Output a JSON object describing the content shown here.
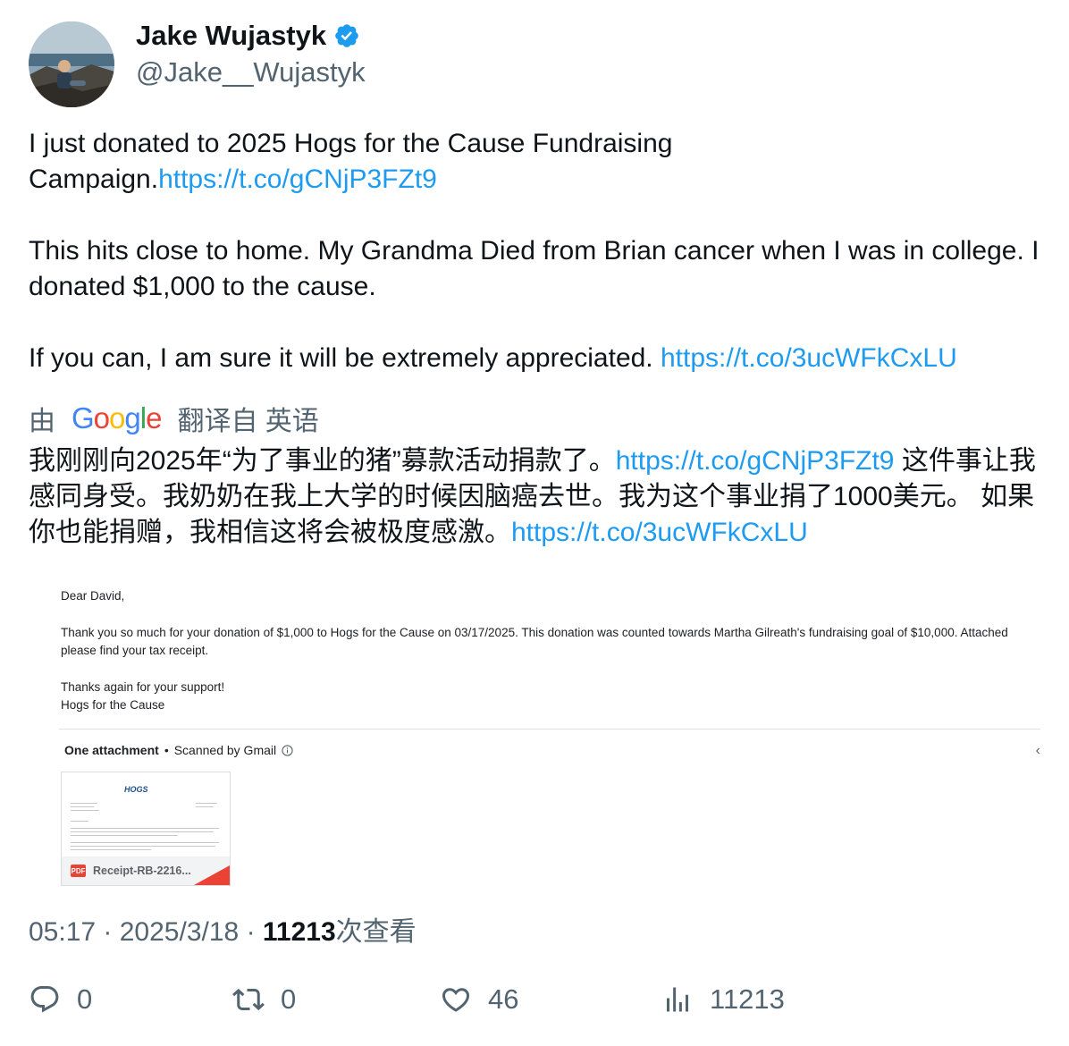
{
  "author": {
    "display_name": "Jake Wujastyk",
    "handle": "@Jake__Wujastyk",
    "verified_icon": "verified-badge-icon"
  },
  "tweet": {
    "p1_text": "I just donated to 2025 Hogs for the Cause Fundraising Campaign.",
    "p1_link": "https://t.co/gCNjP3FZt9",
    "p2_text": "This hits close to home. My Grandma Died from Brian cancer when I was in college. I donated $1,000 to the cause.",
    "p3_text": "If you can, I am sure it will be extremely appreciated. ",
    "p3_link": "https://t.co/3ucWFkCxLU"
  },
  "translation": {
    "prefix": "由",
    "suffix": "翻译自 英语",
    "t1": "我刚刚向2025年“为了事业的猪”募款活动捐款了。",
    "link1": "https://t.co/gCNjP3FZt9",
    "t2": " 这件事让我感同身受。我奶奶在我上大学的时候因脑癌去世。我为这个事业捐了1000美元。 如果你也能捐赠，我相信这将会被极度感激。",
    "link2": "https://t.co/3ucWFkCxLU"
  },
  "email": {
    "greeting": "Dear David,",
    "body_line1": "Thank you so much for your donation of $1,000 to Hogs for the Cause on 03/17/2025.  This donation was counted towards Martha Gilreath's fundraising goal of $10,000.  Attached",
    "body_line2": "please find your tax receipt.",
    "thanks": "Thanks again for your support!",
    "signature": "Hogs for the Cause",
    "attach_count": "One attachment",
    "scanned": "Scanned by Gmail",
    "attachment_name": "Receipt-RB-2216...",
    "pdf_label": "PDF",
    "logo_text": "HOGS"
  },
  "meta": {
    "time": "05:17",
    "date": "2025/3/18",
    "views": "11213",
    "views_label": "次查看"
  },
  "actions": {
    "replies": "0",
    "retweets": "0",
    "likes": "46",
    "views": "11213"
  },
  "colors": {
    "link": "#1d9bf0",
    "secondary_text": "#536471",
    "primary_text": "#0f1419",
    "verified": "#1d9bf0"
  }
}
